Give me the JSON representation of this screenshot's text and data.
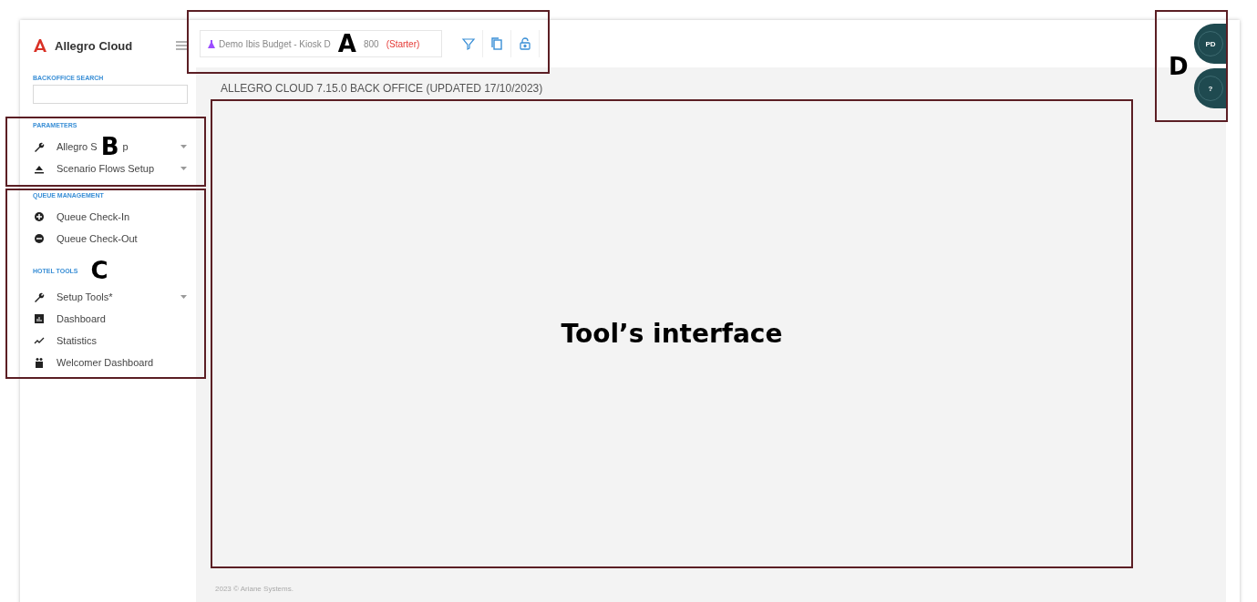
{
  "brand": {
    "name": "Allegro Cloud"
  },
  "search": {
    "heading": "BACKOFFICE SEARCH"
  },
  "sections": [
    {
      "heading": "PARAMETERS",
      "items": [
        {
          "label": "Allegro S",
          "label_tail": "p",
          "callout": "B",
          "expandable": true
        },
        {
          "label": "Scenario Flows Setup",
          "expandable": true
        }
      ]
    },
    {
      "heading": "QUEUE MANAGEMENT",
      "items": [
        {
          "label": "Queue Check-In",
          "expandable": false
        },
        {
          "label": "Queue Check-Out",
          "expandable": false
        }
      ]
    },
    {
      "heading": "HOTEL TOOLS",
      "callout": "C",
      "items": [
        {
          "label": "Setup Tools*",
          "expandable": true
        },
        {
          "label": "Dashboard",
          "expandable": false
        },
        {
          "label": "Statistics",
          "expandable": false
        },
        {
          "label": "Welcomer Dashboard",
          "expandable": false
        }
      ]
    }
  ],
  "property": {
    "name": "Demo Ibis Budget - Kiosk D",
    "callout": "A",
    "name_tail": "800",
    "plan": "(Starter)"
  },
  "page_title": "ALLEGRO CLOUD 7.15.0 BACK OFFICE (UPDATED 17/10/2023)",
  "tool_area": {
    "label": "Tool’s interface"
  },
  "footer": "2023 © Ariane Systems.",
  "side_buttons": [
    {
      "label": "PD"
    },
    {
      "label": "?"
    }
  ],
  "side_callout": "D"
}
